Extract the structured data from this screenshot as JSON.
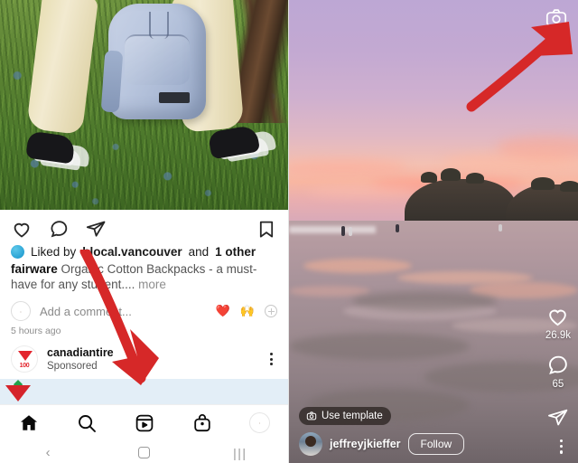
{
  "left_panel": {
    "post_image_alt": "person-with-light-blue-backpack-in-grass",
    "actions": {
      "like_label": "Like",
      "comment_label": "Comment",
      "share_label": "Share",
      "save_label": "Save"
    },
    "likes": {
      "prefix": "Liked by",
      "username": "blocal.vancouver",
      "middle": "and",
      "others": "1 other"
    },
    "caption": {
      "username": "fairware",
      "text": "Organic Cotton Backpacks - a must-have for any student....",
      "more": "more"
    },
    "comment_row": {
      "placeholder": "Add a comment...",
      "emoji_heart": "❤️",
      "emoji_hands": "🙌",
      "add_emoji_label": "+"
    },
    "timestamp": "5 hours ago",
    "sponsored_post": {
      "account": "canadiantire",
      "label": "Sponsored",
      "logo_text": "100",
      "menu_label": "More options"
    },
    "next_banner_label": "next-sponsored-post",
    "tabbar": [
      {
        "name": "home",
        "label": "Home",
        "active": true
      },
      {
        "name": "search",
        "label": "Search",
        "active": false
      },
      {
        "name": "reels",
        "label": "Reels",
        "active": false
      },
      {
        "name": "shop",
        "label": "Shop",
        "active": false
      },
      {
        "name": "profile",
        "label": "Profile",
        "active": false
      }
    ],
    "system_nav": {
      "back": "‹",
      "home": "Home",
      "recents": "|||"
    },
    "annotation": {
      "type": "arrow",
      "color": "#d62828",
      "points_to": "next-sponsored-post-banner"
    }
  },
  "right_panel": {
    "media_alt": "sunset-beach-with-pink-purple-sky-and-tidal-reflections",
    "camera_button_label": "Camera",
    "metrics": {
      "likes": "26.9k",
      "comments": "65"
    },
    "share_label": "Share",
    "menu_label": "More options",
    "template_chip": {
      "icon": "camera-icon",
      "label": "Use template"
    },
    "author": {
      "username": "jeffreyjkieffer",
      "follow_label": "Follow"
    },
    "annotation": {
      "type": "arrow",
      "color": "#d62828",
      "points_to": "camera-button"
    }
  },
  "colors": {
    "accent_red": "#d62828",
    "brand_red": "#e3262e",
    "banner_blue": "#e3eef7",
    "text_primary": "#111111",
    "text_muted": "#8e8e8e"
  }
}
